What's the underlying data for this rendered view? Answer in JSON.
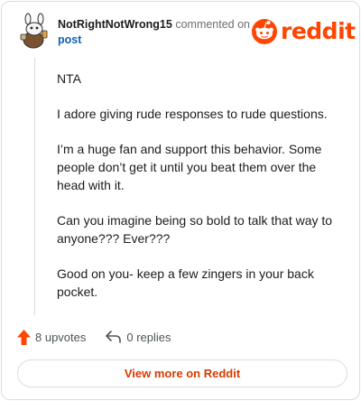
{
  "header": {
    "username": "NotRightNotWrong15",
    "action_text": "commented on",
    "post_link": "post"
  },
  "brand": {
    "wordmark": "reddit",
    "color": "#ff4500"
  },
  "comment": {
    "paragraphs": [
      "NTA",
      "I adore giving rude responses to rude questions.",
      "I’m a huge fan and support this behavior. Some people don’t get it until you beat them over the head with it.",
      "Can you imagine being so bold to talk that way to anyone??? Ever???",
      "Good on you- keep a few zingers in your back pocket."
    ]
  },
  "actions": {
    "upvotes_label": "8 upvotes",
    "replies_label": "0 replies"
  },
  "footer": {
    "view_more_label": "View more on Reddit"
  },
  "icons": {
    "avatar": "snoo-avatar",
    "logo": "reddit-snoo-icon",
    "upvote": "upvote-arrow-icon",
    "reply": "reply-arrow-icon"
  }
}
